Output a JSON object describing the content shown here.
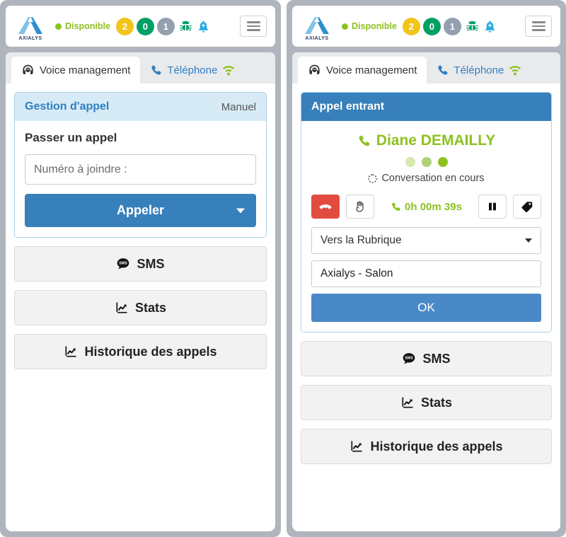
{
  "header": {
    "logo_text": "AXIALYS",
    "logo_icon": "axialys-a-logo",
    "status_label": "Disponible",
    "status_color": "#8cc220",
    "badges": [
      {
        "value": "2",
        "color": "#f0c419",
        "name": "badge-waiting"
      },
      {
        "value": "0",
        "color": "#00a065",
        "name": "badge-active"
      },
      {
        "value": "1",
        "color": "#94a0b0",
        "name": "badge-paused"
      }
    ],
    "bug_icon": "bug-icon",
    "bug_color": "#00a065",
    "bell_icon": "bell-plus-icon",
    "bell_color": "#29abe2",
    "menu_icon": "hamburger-menu-icon"
  },
  "tabs": [
    {
      "label": "Voice management",
      "icon": "headset-icon",
      "active": true
    },
    {
      "label": "Téléphone",
      "icon": "phone-icon",
      "trailing_icon": "wifi-icon",
      "active": false
    }
  ],
  "left": {
    "card": {
      "title": "Gestion d'appel",
      "mode": "Manuel",
      "section_title": "Passer un appel",
      "number_placeholder": "Numéro à joindre :",
      "number_value": "",
      "call_button": "Appeler"
    },
    "actions": [
      {
        "label": "SMS",
        "icon": "sms-bubble-icon"
      },
      {
        "label": "Stats",
        "icon": "chart-line-icon"
      },
      {
        "label": "Historique des appels",
        "icon": "chart-line-icon"
      }
    ]
  },
  "right": {
    "card": {
      "title": "Appel entrant",
      "caller_name": "Diane DEMAILLY",
      "caller_icon": "phone-icon",
      "caller_color": "#8cc220",
      "progress_dots": [
        "#d5e8b0",
        "#aed175",
        "#8cc220"
      ],
      "status_text": "Conversation en cours",
      "status_icon": "spinner-icon",
      "controls": {
        "hangup_icon": "phone-hangup-icon",
        "hangup_color": "#e34b41",
        "hold_icon": "hand-icon",
        "timer": "0h 00m 39s",
        "timer_icon": "phone-icon",
        "timer_color": "#8cc220",
        "pause_icon": "pause-icon",
        "tag_icon": "tag-icon"
      },
      "transfer_select": "Vers la Rubrique",
      "transfer_target": "Axialys - Salon",
      "ok_button": "OK"
    },
    "actions": [
      {
        "label": "SMS",
        "icon": "sms-bubble-icon"
      },
      {
        "label": "Stats",
        "icon": "chart-line-icon"
      },
      {
        "label": "Historique des appels",
        "icon": "chart-line-icon"
      }
    ]
  }
}
